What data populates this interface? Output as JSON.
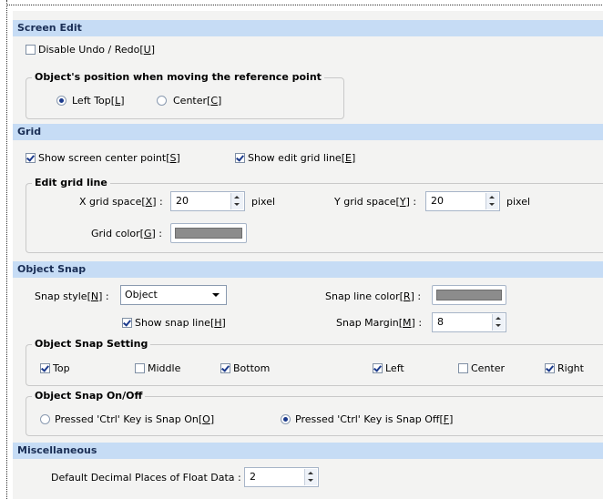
{
  "sections": {
    "screen_edit": "Screen Edit",
    "grid": "Grid",
    "object_snap": "Object Snap",
    "miscellaneous": "Miscellaneous"
  },
  "screen_edit": {
    "disable_undo": {
      "label": "Disable Undo / Redo",
      "key": "U",
      "checked": false
    },
    "position_group": "Object's position when moving the reference point",
    "left_top": {
      "label": "Left Top",
      "key": "L",
      "selected": true
    },
    "center": {
      "label": "Center",
      "key": "C",
      "selected": false
    }
  },
  "grid": {
    "show_center": {
      "label": "Show screen center point",
      "key": "S",
      "checked": true
    },
    "show_grid_line": {
      "label": "Show edit grid line",
      "key": "E",
      "checked": true
    },
    "edit_group": "Edit grid line",
    "x_space": {
      "label": "X grid space",
      "key": "X",
      "value": "20",
      "unit": "pixel"
    },
    "y_space": {
      "label": "Y grid space",
      "key": "Y",
      "value": "20",
      "unit": "pixel"
    },
    "color": {
      "label": "Grid color",
      "key": "G",
      "swatch": "#8c8c8c"
    }
  },
  "object_snap": {
    "style": {
      "label": "Snap style",
      "key": "N",
      "value": "Object"
    },
    "line_color": {
      "label": "Snap line color",
      "key": "R",
      "swatch": "#8c8c8c"
    },
    "show_snap_line": {
      "label": "Show snap line",
      "key": "H",
      "checked": true
    },
    "margin": {
      "label": "Snap Margin",
      "key": "M",
      "value": "8"
    },
    "setting_group": "Object Snap Setting",
    "top": {
      "label": "Top",
      "checked": true
    },
    "middle": {
      "label": "Middle",
      "checked": false
    },
    "bottom": {
      "label": "Bottom",
      "checked": true
    },
    "left": {
      "label": "Left",
      "checked": true
    },
    "center": {
      "label": "Center",
      "checked": false
    },
    "right": {
      "label": "Right",
      "checked": true
    },
    "onoff_group": "Object Snap On/Off",
    "ctrl_on": {
      "label": "Pressed 'Ctrl' Key is Snap On",
      "key": "O",
      "selected": false
    },
    "ctrl_off": {
      "label": "Pressed 'Ctrl' Key is Snap Off",
      "key": "F",
      "selected": true
    }
  },
  "misc": {
    "decimal": {
      "label": "Default Decimal Places of Float Data",
      "value": "2"
    }
  },
  "colon": ":",
  "colors": {
    "header_bg": "#c6dcf5",
    "panel_bg": "#f3f3f2",
    "accent": "#1b3a8c"
  }
}
